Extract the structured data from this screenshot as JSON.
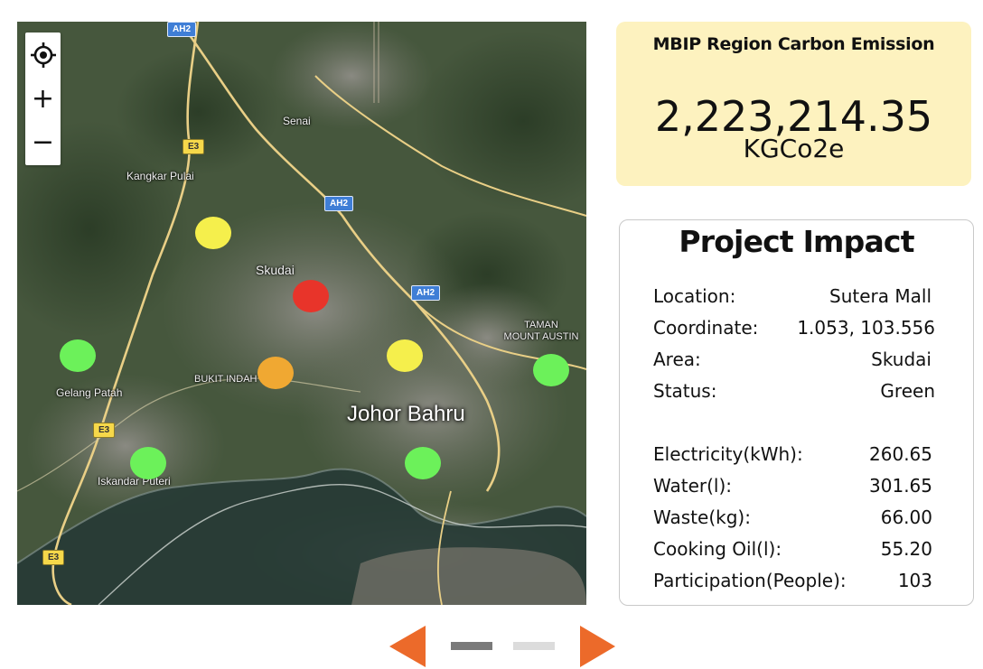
{
  "map": {
    "labels": {
      "skudai": "Skudai",
      "senai": "Senai",
      "kangkar_pulai": "Kangkar Pulai",
      "bukit_indah": "BUKIT INDAH",
      "gelang_patah": "Gelang Patah",
      "iskandar_puteri": "Iskandar Puteri",
      "johor_bahru": "Johor Bahru",
      "taman_mount_austin_1": "TAMAN",
      "taman_mount_austin_2": "MOUNT AUSTIN"
    },
    "shields": {
      "ah2_top": "AH2",
      "ah2_mid": "AH2",
      "ah2_right": "AH2",
      "e3_top": "E3",
      "e3_mid": "E3",
      "e3_bottom": "E3"
    },
    "markers": [
      {
        "status": "yellow",
        "color": "#f5ef4c"
      },
      {
        "status": "red",
        "color": "#e8342a"
      },
      {
        "status": "green",
        "color": "#6cf15a"
      },
      {
        "status": "orange",
        "color": "#f0a832"
      },
      {
        "status": "yellow",
        "color": "#f5ef4c"
      },
      {
        "status": "green",
        "color": "#6cf15a"
      },
      {
        "status": "green",
        "color": "#6cf15a"
      },
      {
        "status": "green",
        "color": "#6cf15a"
      }
    ],
    "controls": {
      "locate_icon": "crosshair-icon",
      "zoom_in": "+",
      "zoom_out": "−"
    }
  },
  "emission": {
    "title": "MBIP Region Carbon Emission",
    "value": "2,223,214.35",
    "unit": "KGCo2e",
    "background": "#fdf2bf"
  },
  "impact": {
    "title": "Project Impact",
    "rows": [
      {
        "label": "Location:",
        "value": "Sutera Mall"
      },
      {
        "label": "Coordinate:",
        "value": "1.053, 103.556"
      },
      {
        "label": "Area:",
        "value": "Skudai"
      },
      {
        "label": "Status:",
        "value": "Green"
      },
      {
        "label": "Electricity(kWh):",
        "value": "260.65"
      },
      {
        "label": "Water(l):",
        "value": "301.65"
      },
      {
        "label": "Waste(kg):",
        "value": "66.00"
      },
      {
        "label": "Cooking Oil(l):",
        "value": "55.20"
      },
      {
        "label": "Participation(People):",
        "value": "103"
      }
    ]
  },
  "pager": {
    "arrow_color": "#ec6a2a",
    "active_dash_color": "#7a7a7a",
    "inactive_dash_color": "#dcdcdc",
    "pages": 2,
    "current_page": 1
  }
}
